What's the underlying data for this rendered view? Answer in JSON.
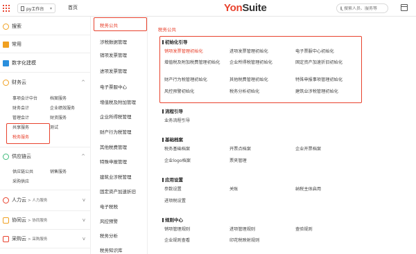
{
  "topbar": {
    "workspace": "py工作台",
    "home": "首页",
    "logo_a": "Yon",
    "logo_b": "Suite",
    "search_placeholder": "搜索人员、服务等"
  },
  "leftnav": {
    "search": "搜索",
    "common": "常用",
    "digital": "数字化建模",
    "finance": "财务云",
    "finance_subs": [
      "事项会计中台",
      "档案服务",
      "财务会计",
      "企业绩效服务",
      "管理会计",
      "财资服务",
      "共享服务",
      "测试",
      "税务服务"
    ],
    "supply": "供应链云",
    "supply_subs": [
      "供应链公共",
      "销售服务",
      "采购供应"
    ],
    "hr": "人力云",
    "hr_sub": "> 人力服务",
    "collab": "协同云",
    "collab_sub": "> 协同服务",
    "purchase": "采购云",
    "purchase_sub": "> 采购服务"
  },
  "midcol": {
    "items": [
      "税务公共",
      "涉税数据管理",
      "销项发票管理",
      "进项发票管理",
      "电子票服中心",
      "增值税及附加管理",
      "企业所得税管理",
      "财产行为税管理",
      "其他税费管理",
      "特殊申报管理",
      "建筑业涉税管理",
      "固定资产加速折旧",
      "电子税税",
      "风控预警",
      "税务分析",
      "税务知识库"
    ]
  },
  "content": {
    "breadcrumb": "税务公共",
    "init": {
      "title": "初始化引导",
      "items": [
        "销项发票管理初始化",
        "进项发票管理初始化",
        "电子票服中心初始化",
        "增值税及附加税费管理初始化",
        "企业所得税管理初始化",
        "固定资产加速折旧初始化",
        "财产行为税管理初始化",
        "其他税费管理初始化",
        "特殊申报事项管理初始化",
        "风控预警初始化",
        "税务分析初始化",
        "建筑业涉税管理初始化"
      ]
    },
    "flow": {
      "title": "流程引导",
      "items": [
        "业务流程引导"
      ]
    },
    "archive": {
      "title": "基础档案",
      "items": [
        "税务基础档案",
        "开票点档案",
        "企业开票档案",
        "企业logo档案",
        "票夹管理"
      ]
    },
    "app": {
      "title": "应用设置",
      "items": [
        "参数设置",
        "关账",
        "纳税主体启用",
        "进项税设置"
      ]
    },
    "rules": {
      "title": "规则中心",
      "items": [
        "销项管理规则",
        "进项管理规则",
        "查验规则",
        "企业规则查看",
        "印花税映射规则"
      ]
    }
  }
}
